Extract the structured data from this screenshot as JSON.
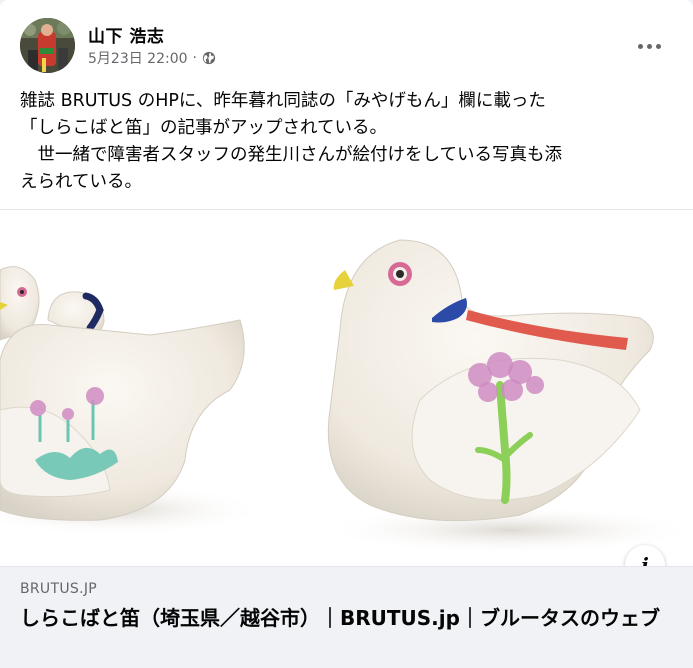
{
  "post": {
    "author": "山下 浩志",
    "timestamp": "5月23日 22:00",
    "separator": "·",
    "privacy_icon": "globe-icon",
    "more_icon": "more-horizontal-icon",
    "text_lines": [
      "雑誌 BRUTUS のHPに、昨年暮れ同誌の「みやげもん」欄に載った",
      "「しらこばと笛」の記事がアップされている。",
      "　世一緒で障害者スタッフの発生川さんが絵付けをしている写真も添",
      "えられている。"
    ]
  },
  "link_preview": {
    "domain": "BRUTUS.JP",
    "title": "しらこばと笛（埼玉県／越谷市）｜BRUTUS.jp｜ブルータスのウェブ",
    "info_label": "i"
  },
  "colors": {
    "text_primary": "#050505",
    "text_secondary": "#65676b",
    "footer_bg": "#f0f2f5",
    "bird_body": "#f3efe8",
    "beak": "#e6d23a",
    "eye": "#d66a95",
    "neck_band": "#2c4aa8",
    "wing_stripe": "#e05a4e",
    "flower_pink": "#cf8bc2",
    "stem_green": "#8ccf59",
    "leaf_teal": "#6cc4b3"
  }
}
